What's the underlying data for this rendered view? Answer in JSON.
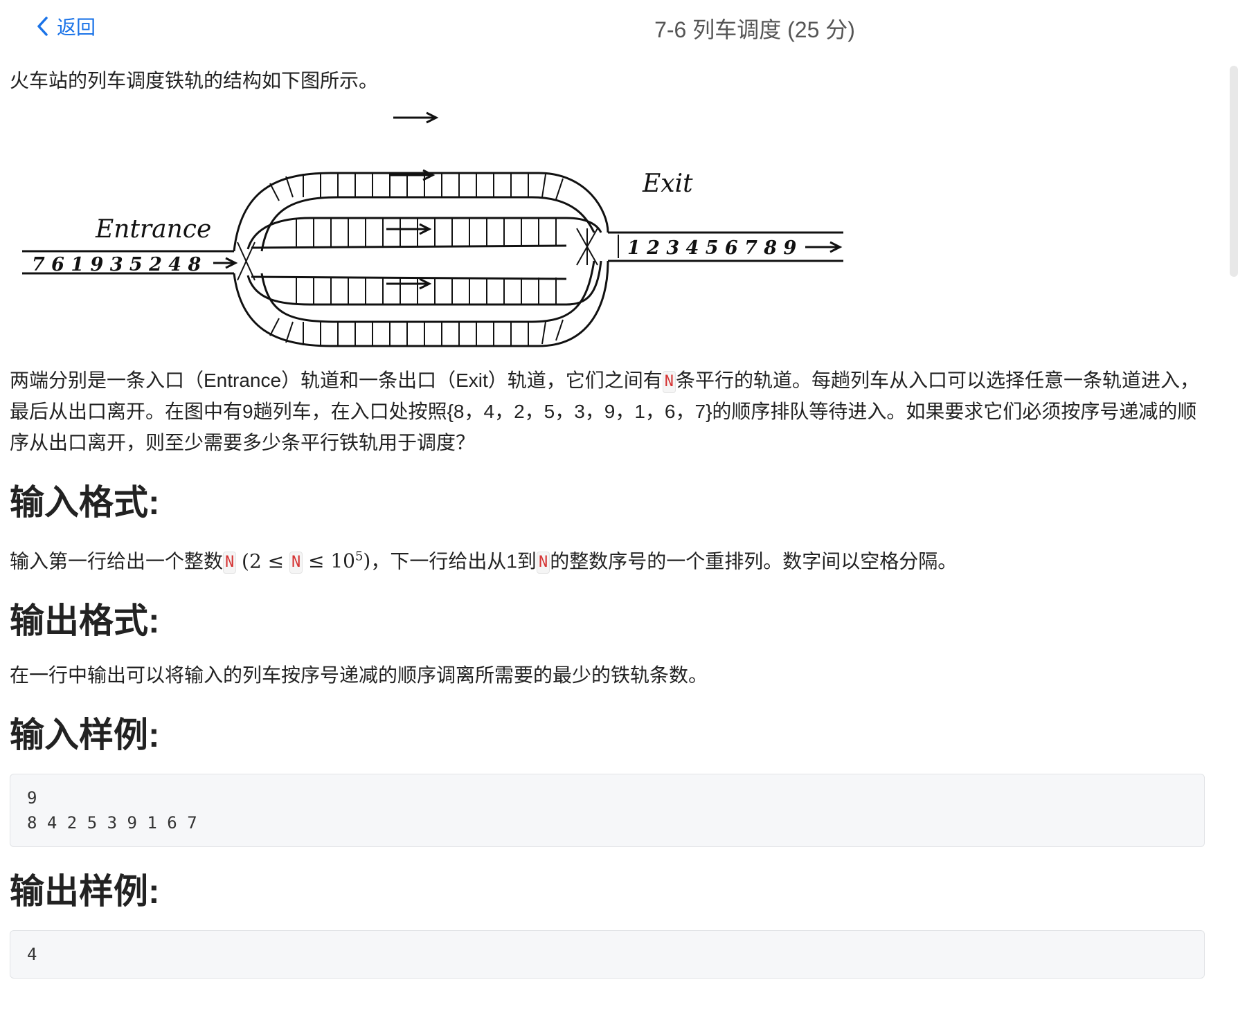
{
  "header": {
    "back_label": "返回",
    "title": "7-6 列车调度 (25 分)"
  },
  "intro": "火车站的列车调度铁轨的结构如下图所示。",
  "figure": {
    "entrance_label": "Entrance",
    "exit_label": "Exit",
    "entrance_sequence": "7 6 1 9 3 5 2 4 8",
    "exit_sequence": "1 2 3 4 5 6 7 8 9",
    "icons": [
      "right-arrow-icon"
    ]
  },
  "description": {
    "part1": "两端分别是一条入口（Entrance）轨道和一条出口（Exit）轨道，它们之间有",
    "var": "N",
    "part2": "条平行的轨道。每趟列车从入口可以选择任意一条轨道进入，最后从出口离开。在图中有9趟列车，在入口处按照{8，4，2，5，3，9，1，6，7}的顺序排队等待进入。如果要求它们必须按序号递减的顺序从出口离开，则至少需要多少条平行铁轨用于调度？"
  },
  "sections": {
    "input_format": {
      "heading": "输入格式:",
      "text1": "输入第一行给出一个整数",
      "var": "N",
      "math_open": "(2 ≤",
      "math_close": "≤ 10",
      "math_exp": "5",
      "math_end": ")",
      "text2": "，下一行给出从1到",
      "text3": "的整数序号的一个重排列。数字间以空格分隔。"
    },
    "output_format": {
      "heading": "输出格式:",
      "text": "在一行中输出可以将输入的列车按序号递减的顺序调离所需要的最少的铁轨条数。"
    },
    "sample_input": {
      "heading": "输入样例:",
      "lines": [
        "9",
        "8 4 2 5 3 9 1 6 7"
      ]
    },
    "sample_output": {
      "heading": "输出样例:",
      "lines": [
        "4"
      ]
    }
  },
  "colors": {
    "accent": "#1a73e8",
    "var_color": "#d53333"
  }
}
